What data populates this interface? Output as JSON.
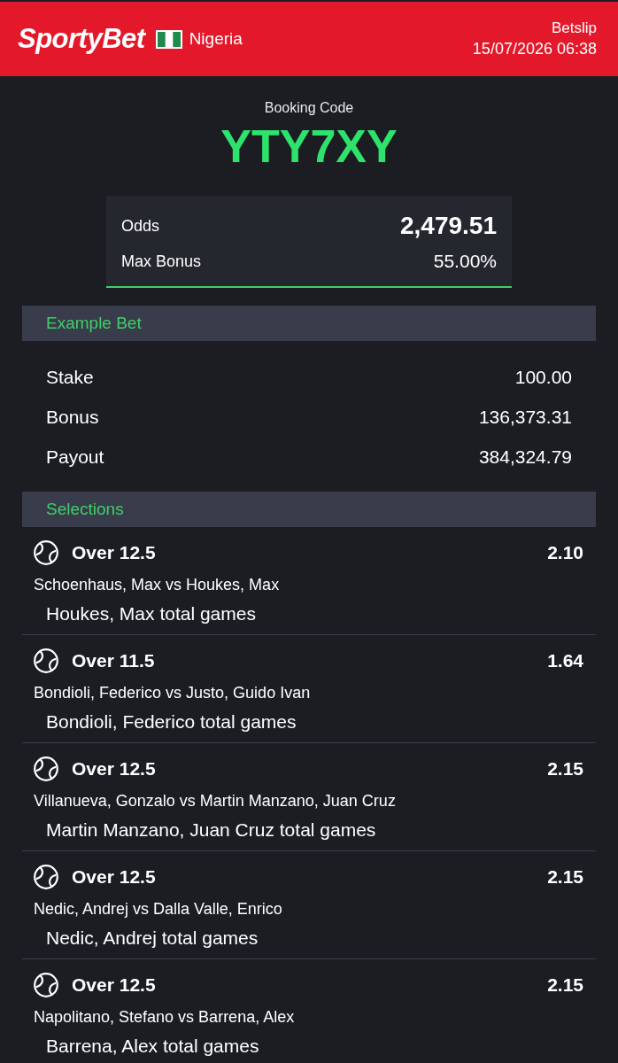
{
  "header": {
    "logo": "SportyBet",
    "country": "Nigeria",
    "title": "Betslip",
    "datetime": "15/07/2026 06:38"
  },
  "booking": {
    "label": "Booking Code",
    "code": "YTY7XY"
  },
  "summary": {
    "rows": [
      {
        "kind": "emphasis",
        "label": "Odds",
        "value": "2,479.51"
      },
      {
        "kind": "plain",
        "label": "Max Bonus",
        "value": "55.00%"
      }
    ]
  },
  "example_bet": {
    "title": "Example Bet",
    "rows": [
      {
        "label": "Stake",
        "value": "100.00"
      },
      {
        "label": "Bonus",
        "value": "136,373.31"
      },
      {
        "label": "Payout",
        "value": "384,324.79"
      }
    ]
  },
  "selections": {
    "title": "Selections",
    "items": [
      {
        "pick": "Over 12.5",
        "odds": "2.10",
        "match": "Schoenhaus, Max vs Houkes, Max",
        "market": "Houkes, Max total games"
      },
      {
        "pick": "Over 11.5",
        "odds": "1.64",
        "match": "Bondioli, Federico vs Justo, Guido Ivan",
        "market": "Bondioli, Federico total games"
      },
      {
        "pick": "Over 12.5",
        "odds": "2.15",
        "match": "Villanueva, Gonzalo vs Martin Manzano, Juan Cruz",
        "market": "Martin Manzano, Juan Cruz total games"
      },
      {
        "pick": "Over 12.5",
        "odds": "2.15",
        "match": "Nedic, Andrej vs Dalla Valle, Enrico",
        "market": "Nedic, Andrej total games"
      },
      {
        "pick": "Over 12.5",
        "odds": "2.15",
        "match": "Napolitano, Stefano vs Barrena, Alex",
        "market": "Barrena, Alex total games"
      }
    ]
  }
}
